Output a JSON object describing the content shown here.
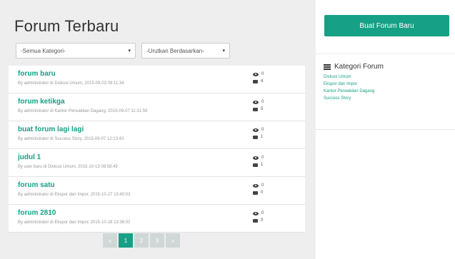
{
  "main": {
    "title": "Forum Terbaru",
    "filters": {
      "category": "-Semua Kategori-",
      "sort": "-Urutkan Berdasarkan-"
    },
    "posts": [
      {
        "title": "forum baru",
        "meta": "By administrator di Diskusi Umum, 2015-09-03 09:11:34",
        "views": "0",
        "comments": "4"
      },
      {
        "title": "forum ketikga",
        "meta": "By administrator di Kantor Perwakilan Dagang, 2015-09-07 11:31:59",
        "views": "0",
        "comments": "5"
      },
      {
        "title": "buat forum lagi lagi",
        "meta": "By administrator di Success Story, 2015-09-07 12:13:43",
        "views": "0",
        "comments": "1"
      },
      {
        "title": "judul 1",
        "meta": "By user baru di Diskusi Umum, 2015-10-13 08:58:49",
        "views": "0",
        "comments": "1"
      },
      {
        "title": "forum satu",
        "meta": "By administrator di Ekspor dan Impor, 2015-10-27 13:40:03",
        "views": "0",
        "comments": "0"
      },
      {
        "title": "forum 2810",
        "meta": "By administrator di Ekspor dan Impor, 2015-10-28 13:36:02",
        "views": "0",
        "comments": "0"
      }
    ],
    "pagination": {
      "prev": "«",
      "pages": [
        "1",
        "2",
        "3"
      ],
      "next": "»",
      "active": "1"
    }
  },
  "sidebar": {
    "new_forum_button": "Buat Forum Baru",
    "categories_title": "Kategori Forum",
    "categories": [
      "Diskusi Umum",
      "Ekspor dan Impor",
      "Kantor Perwakilan Dagang",
      "Success Story"
    ]
  },
  "colors": {
    "accent": "#16a085",
    "background": "#eeeeee"
  }
}
